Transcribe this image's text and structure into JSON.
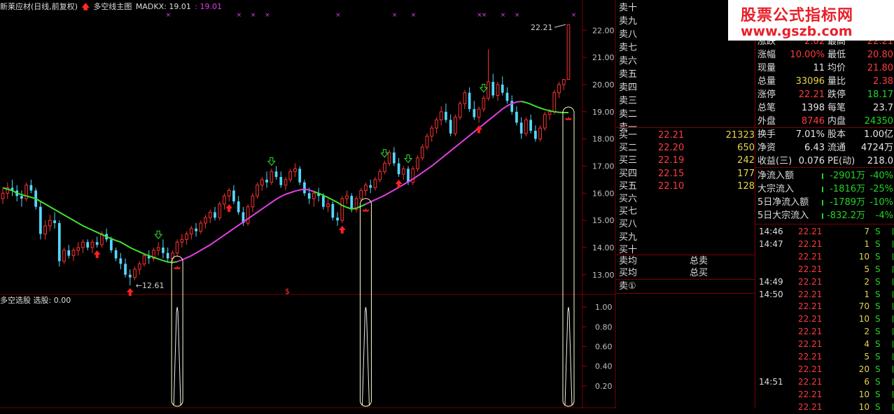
{
  "header": {
    "stock_name": "新莱应材(日线,前复权)",
    "indicator_name": "多空线主图",
    "madkx_label": "MADKX: 19.01",
    "madkx_value": ": 19.01"
  },
  "sub_header": {
    "name": "多空选股",
    "value_label": "选股: 0.00"
  },
  "annotations": {
    "high_label": "22.21",
    "low_label": "12.61",
    "dollar": "$"
  },
  "watermark": {
    "line1": "股票公式指标网",
    "line2": "www.gszb.com"
  },
  "order_book": {
    "sell": [
      "卖十",
      "卖九",
      "卖八",
      "卖七",
      "卖六",
      "卖五",
      "卖四",
      "卖三",
      "卖二",
      "卖一"
    ],
    "buy": [
      {
        "label": "买一",
        "price": "22.21",
        "vol": "21323"
      },
      {
        "label": "买二",
        "price": "22.20",
        "vol": "650"
      },
      {
        "label": "买三",
        "price": "22.19",
        "vol": "242"
      },
      {
        "label": "买四",
        "price": "22.15",
        "vol": "177"
      },
      {
        "label": "买五",
        "price": "22.10",
        "vol": "128"
      },
      {
        "label": "买六",
        "price": "",
        "vol": ""
      },
      {
        "label": "买七",
        "price": "",
        "vol": ""
      },
      {
        "label": "买八",
        "price": "",
        "vol": ""
      },
      {
        "label": "买九",
        "price": "",
        "vol": ""
      },
      {
        "label": "买十",
        "price": "",
        "vol": ""
      }
    ],
    "avg_sell": "卖均",
    "avg_buy": "买均",
    "total_sell": "总卖",
    "total_buy": "总买",
    "sell_one": "卖①"
  },
  "stats": [
    {
      "l1": "涨跌",
      "v1": "2.02",
      "l2": "最高",
      "v2": "22.21",
      "c1": "red",
      "c2": "red"
    },
    {
      "l1": "涨幅",
      "v1": "10.00%",
      "l2": "最低",
      "v2": "20.80",
      "c1": "red",
      "c2": "red"
    },
    {
      "l1": "现量",
      "v1": "11",
      "l2": "均价",
      "v2": "21.80",
      "c1": "white",
      "c2": "red"
    },
    {
      "l1": "总量",
      "v1": "33096",
      "l2": "量比",
      "v2": "2.38",
      "c1": "yellow",
      "c2": "red"
    },
    {
      "l1": "涨停",
      "v1": "22.21",
      "l2": "跌停",
      "v2": "18.17",
      "c1": "red",
      "c2": "green"
    },
    {
      "l1": "总笔",
      "v1": "1398",
      "l2": "每笔",
      "v2": "23.7",
      "c1": "white",
      "c2": "white"
    },
    {
      "l1": "外盘",
      "v1": "8746",
      "l2": "内盘",
      "v2": "24350",
      "c1": "red",
      "c2": "green"
    },
    {
      "l1": "换手",
      "v1": "7.01%",
      "l2": "股本",
      "v2": "1.00亿",
      "c1": "white",
      "c2": "white"
    },
    {
      "l1": "净资",
      "v1": "6.43",
      "l2": "流通",
      "v2": "4724万",
      "c1": "white",
      "c2": "white"
    },
    {
      "l1": "收益(三)",
      "v1": "0.076",
      "l2": "PE(动)",
      "v2": "218.0",
      "c1": "white",
      "c2": "white"
    }
  ],
  "flows": [
    {
      "label": "净流入额",
      "value": "-2901万",
      "pct": "-40%"
    },
    {
      "label": "大宗流入",
      "value": "-1816万",
      "pct": "-25%"
    },
    {
      "label": "5日净流入额",
      "value": "-1789万",
      "pct": "-10%"
    },
    {
      "label": "5日大宗流入",
      "value": "-832.2万",
      "pct": "-4%"
    }
  ],
  "ticks": [
    {
      "time": "14:46",
      "price": "22.21",
      "vol": "7",
      "side": "S"
    },
    {
      "time": "14:47",
      "price": "22.21",
      "vol": "1",
      "side": "S"
    },
    {
      "time": "",
      "price": "22.21",
      "vol": "10",
      "side": "S"
    },
    {
      "time": "",
      "price": "22.21",
      "vol": "5",
      "side": "S"
    },
    {
      "time": "14:49",
      "price": "22.21",
      "vol": "2",
      "side": "S"
    },
    {
      "time": "14:50",
      "price": "22.21",
      "vol": "1",
      "side": "S"
    },
    {
      "time": "",
      "price": "22.21",
      "vol": "70",
      "side": "S"
    },
    {
      "time": "",
      "price": "22.21",
      "vol": "10",
      "side": "S"
    },
    {
      "time": "",
      "price": "22.21",
      "vol": "2",
      "side": "S"
    },
    {
      "time": "",
      "price": "22.21",
      "vol": "4",
      "side": "S"
    },
    {
      "time": "",
      "price": "22.21",
      "vol": "5",
      "side": "S"
    },
    {
      "time": "",
      "price": "22.21",
      "vol": "20",
      "side": "S"
    },
    {
      "time": "14:51",
      "price": "22.21",
      "vol": "6",
      "side": "S"
    },
    {
      "time": "",
      "price": "22.21",
      "vol": "10",
      "side": "S"
    },
    {
      "time": "",
      "price": "22.21",
      "vol": "10",
      "side": "S"
    }
  ],
  "chart_data": [
    {
      "type": "candlestick",
      "title": "多空线主图",
      "ylim": [
        12.3,
        22.6
      ],
      "yticks": [
        "22.00",
        "21.00",
        "20.00",
        "19.00",
        "18.00",
        "17.00",
        "16.00",
        "15.00",
        "14.00",
        "13.00"
      ],
      "ytick_values": [
        22,
        21,
        20,
        19,
        18,
        17,
        16,
        15,
        14,
        13
      ],
      "colors": {
        "up": "#ff3030",
        "down": "#54d8ff",
        "bull_line": "#e040e0",
        "bear_line": "#40e030"
      },
      "candles": [
        [
          15.8,
          16.2,
          15.6,
          16.0
        ],
        [
          16.0,
          16.4,
          15.8,
          16.2
        ],
        [
          16.2,
          16.5,
          15.9,
          16.1
        ],
        [
          16.1,
          16.3,
          15.7,
          15.9
        ],
        [
          15.9,
          16.1,
          15.5,
          15.8
        ],
        [
          15.8,
          16.4,
          15.7,
          16.3
        ],
        [
          16.3,
          16.5,
          16.0,
          16.1
        ],
        [
          16.1,
          16.2,
          15.4,
          15.5
        ],
        [
          15.5,
          15.7,
          14.3,
          14.5
        ],
        [
          14.5,
          15.0,
          14.3,
          14.8
        ],
        [
          14.8,
          15.2,
          14.6,
          15.0
        ],
        [
          15.0,
          15.3,
          14.7,
          14.9
        ],
        [
          14.9,
          15.0,
          13.3,
          13.5
        ],
        [
          13.5,
          14.0,
          13.4,
          13.9
        ],
        [
          13.9,
          14.1,
          13.6,
          13.7
        ],
        [
          13.7,
          14.0,
          13.5,
          13.9
        ],
        [
          13.9,
          14.2,
          13.7,
          14.0
        ],
        [
          14.0,
          14.3,
          13.8,
          14.2
        ],
        [
          14.2,
          14.3,
          13.9,
          14.0
        ],
        [
          14.0,
          14.3,
          13.8,
          14.2
        ],
        [
          14.2,
          14.4,
          14.0,
          14.1
        ],
        [
          14.1,
          14.6,
          14.0,
          14.5
        ],
        [
          14.5,
          14.7,
          14.2,
          14.3
        ],
        [
          14.3,
          14.4,
          13.8,
          13.9
        ],
        [
          13.9,
          14.0,
          13.5,
          13.6
        ],
        [
          13.6,
          13.8,
          13.2,
          13.4
        ],
        [
          13.4,
          13.6,
          12.9,
          13.0
        ],
        [
          13.0,
          13.2,
          12.61,
          12.9
        ],
        [
          12.9,
          13.3,
          12.8,
          13.2
        ],
        [
          13.2,
          13.5,
          13.0,
          13.4
        ],
        [
          13.4,
          13.8,
          13.3,
          13.7
        ],
        [
          13.7,
          13.9,
          13.4,
          13.6
        ],
        [
          13.6,
          14.0,
          13.5,
          13.9
        ],
        [
          13.9,
          14.2,
          13.7,
          14.0
        ],
        [
          14.0,
          14.3,
          13.6,
          13.8
        ],
        [
          13.8,
          14.0,
          13.5,
          13.6
        ],
        [
          13.6,
          13.9,
          13.4,
          13.8
        ],
        [
          13.8,
          14.3,
          13.7,
          14.2
        ],
        [
          14.2,
          14.5,
          14.0,
          14.3
        ],
        [
          14.3,
          14.6,
          14.1,
          14.5
        ],
        [
          14.5,
          14.8,
          14.3,
          14.7
        ],
        [
          14.7,
          14.9,
          14.4,
          14.6
        ],
        [
          14.6,
          15.0,
          14.5,
          14.9
        ],
        [
          14.9,
          15.2,
          14.7,
          15.1
        ],
        [
          15.1,
          15.4,
          14.9,
          15.3
        ],
        [
          15.3,
          15.5,
          15.0,
          15.1
        ],
        [
          15.1,
          15.7,
          15.0,
          15.6
        ],
        [
          15.6,
          16.0,
          15.4,
          15.9
        ],
        [
          15.9,
          16.2,
          15.7,
          16.1
        ],
        [
          16.1,
          16.3,
          15.6,
          15.7
        ],
        [
          15.7,
          15.9,
          15.2,
          15.3
        ],
        [
          15.3,
          15.5,
          14.8,
          14.9
        ],
        [
          14.9,
          15.6,
          14.8,
          15.5
        ],
        [
          15.5,
          16.0,
          15.3,
          15.9
        ],
        [
          15.9,
          16.4,
          15.8,
          16.3
        ],
        [
          16.3,
          16.6,
          16.1,
          16.5
        ],
        [
          16.5,
          16.8,
          16.2,
          16.4
        ],
        [
          16.4,
          16.9,
          16.3,
          16.8
        ],
        [
          16.8,
          17.0,
          16.5,
          16.6
        ],
        [
          16.6,
          16.8,
          16.2,
          16.3
        ],
        [
          16.3,
          16.6,
          16.1,
          16.5
        ],
        [
          16.5,
          16.9,
          16.4,
          16.8
        ],
        [
          16.8,
          17.1,
          16.6,
          16.9
        ],
        [
          16.9,
          17.0,
          16.3,
          16.4
        ],
        [
          16.4,
          16.5,
          15.9,
          16.0
        ],
        [
          16.0,
          16.2,
          15.6,
          15.8
        ],
        [
          15.8,
          16.1,
          15.5,
          16.0
        ],
        [
          16.0,
          16.2,
          15.7,
          15.9
        ],
        [
          15.9,
          16.0,
          15.4,
          15.5
        ],
        [
          15.5,
          15.8,
          15.3,
          15.6
        ],
        [
          15.6,
          15.7,
          15.0,
          15.1
        ],
        [
          15.1,
          15.3,
          14.8,
          15.0
        ],
        [
          15.0,
          15.9,
          14.9,
          15.8
        ],
        [
          15.8,
          16.1,
          15.6,
          15.9
        ],
        [
          15.9,
          16.0,
          15.3,
          15.4
        ],
        [
          15.4,
          15.9,
          15.3,
          15.8
        ],
        [
          15.8,
          16.2,
          15.7,
          16.1
        ],
        [
          16.1,
          16.4,
          15.9,
          16.3
        ],
        [
          16.3,
          16.5,
          16.0,
          16.2
        ],
        [
          16.2,
          16.6,
          16.1,
          16.5
        ],
        [
          16.5,
          16.9,
          16.4,
          16.8
        ],
        [
          16.8,
          17.2,
          16.7,
          17.1
        ],
        [
          17.1,
          17.6,
          17.0,
          17.5
        ],
        [
          17.5,
          17.7,
          17.0,
          17.1
        ],
        [
          17.1,
          17.3,
          16.6,
          16.7
        ],
        [
          16.7,
          17.0,
          16.5,
          16.9
        ],
        [
          16.9,
          17.0,
          16.3,
          16.4
        ],
        [
          16.4,
          17.0,
          16.3,
          16.9
        ],
        [
          16.9,
          17.4,
          16.8,
          17.3
        ],
        [
          17.3,
          17.8,
          17.2,
          17.7
        ],
        [
          17.7,
          18.2,
          17.6,
          18.1
        ],
        [
          18.1,
          18.5,
          17.9,
          18.4
        ],
        [
          18.4,
          18.8,
          18.2,
          18.7
        ],
        [
          18.7,
          19.2,
          18.5,
          19.0
        ],
        [
          19.0,
          19.3,
          18.6,
          18.7
        ],
        [
          18.7,
          18.9,
          18.1,
          18.2
        ],
        [
          18.2,
          18.9,
          18.1,
          18.8
        ],
        [
          18.8,
          19.4,
          18.7,
          19.3
        ],
        [
          19.3,
          19.8,
          19.1,
          19.7
        ],
        [
          19.7,
          19.9,
          19.0,
          19.1
        ],
        [
          19.1,
          19.4,
          18.7,
          18.8
        ],
        [
          18.8,
          19.2,
          18.6,
          19.1
        ],
        [
          19.1,
          19.6,
          19.0,
          19.5
        ],
        [
          19.5,
          21.3,
          19.4,
          20.1
        ],
        [
          20.1,
          20.4,
          19.5,
          19.6
        ],
        [
          19.6,
          20.1,
          19.4,
          20.0
        ],
        [
          20.0,
          20.3,
          19.6,
          19.7
        ],
        [
          19.7,
          19.9,
          19.3,
          19.4
        ],
        [
          19.4,
          19.6,
          18.9,
          19.0
        ],
        [
          19.0,
          19.2,
          18.5,
          18.6
        ],
        [
          18.6,
          18.8,
          18.0,
          18.2
        ],
        [
          18.2,
          18.8,
          18.1,
          18.7
        ],
        [
          18.7,
          18.9,
          18.2,
          18.3
        ],
        [
          18.3,
          18.5,
          17.9,
          18.0
        ],
        [
          18.0,
          18.5,
          17.9,
          18.4
        ],
        [
          18.4,
          19.0,
          18.3,
          18.9
        ],
        [
          18.9,
          19.1,
          18.7,
          19.0
        ],
        [
          19.0,
          19.8,
          18.9,
          19.7
        ],
        [
          19.7,
          20.1,
          19.5,
          20.0
        ],
        [
          20.0,
          20.2,
          19.8,
          20.19
        ],
        [
          20.19,
          22.21,
          20.8,
          22.21
        ]
      ],
      "madkx": [
        16.2,
        16.15,
        16.1,
        16.0,
        15.95,
        15.9,
        15.85,
        15.8,
        15.7,
        15.6,
        15.5,
        15.4,
        15.3,
        15.2,
        15.1,
        15.0,
        14.9,
        14.8,
        14.72,
        14.64,
        14.56,
        14.48,
        14.4,
        14.33,
        14.26,
        14.2,
        14.1,
        14.0,
        13.92,
        13.84,
        13.76,
        13.7,
        13.64,
        13.58,
        13.52,
        13.47,
        13.45,
        13.48,
        13.55,
        13.62,
        13.7,
        13.8,
        13.9,
        14.0,
        14.1,
        14.22,
        14.34,
        14.46,
        14.58,
        14.7,
        14.82,
        14.94,
        15.06,
        15.18,
        15.3,
        15.42,
        15.54,
        15.66,
        15.78,
        15.88,
        15.96,
        16.02,
        16.08,
        16.12,
        16.15,
        16.12,
        16.06,
        16.0,
        15.92,
        15.84,
        15.75,
        15.66,
        15.55,
        15.48,
        15.42,
        15.45,
        15.52,
        15.6,
        15.68,
        15.76,
        15.84,
        15.92,
        16.02,
        16.12,
        16.22,
        16.32,
        16.42,
        16.52,
        16.64,
        16.76,
        16.88,
        17.0,
        17.14,
        17.28,
        17.42,
        17.56,
        17.7,
        17.84,
        17.98,
        18.12,
        18.26,
        18.4,
        18.54,
        18.68,
        18.82,
        18.96,
        19.1,
        19.22,
        19.3,
        19.36,
        19.38,
        19.34,
        19.28,
        19.2,
        19.14,
        19.08,
        19.04,
        19.0,
        18.98,
        18.97,
        18.97,
        18.98,
        19.0,
        19.01
      ],
      "madkx_trend": "bear 0-37, bull 37-66, bear 66-77, bull 77-110, bear 110-121",
      "marks": {
        "buy_arrows": [
          20,
          27,
          48,
          72,
          84,
          101
        ],
        "sell_arrows": [
          33,
          57,
          81,
          86,
          102
        ],
        "x_marks": [
          35,
          50,
          53,
          56,
          71,
          83,
          87,
          101,
          102,
          106,
          109,
          121
        ]
      }
    },
    {
      "type": "line",
      "title": "多空选股",
      "ylim": [
        0,
        1.1
      ],
      "yticks": [
        "1.00",
        "0.80",
        "0.60",
        "0.40",
        "0.20"
      ],
      "ytick_values": [
        1.0,
        0.8,
        0.6,
        0.4,
        0.2
      ],
      "signals_at": [
        37,
        77,
        120
      ]
    }
  ]
}
